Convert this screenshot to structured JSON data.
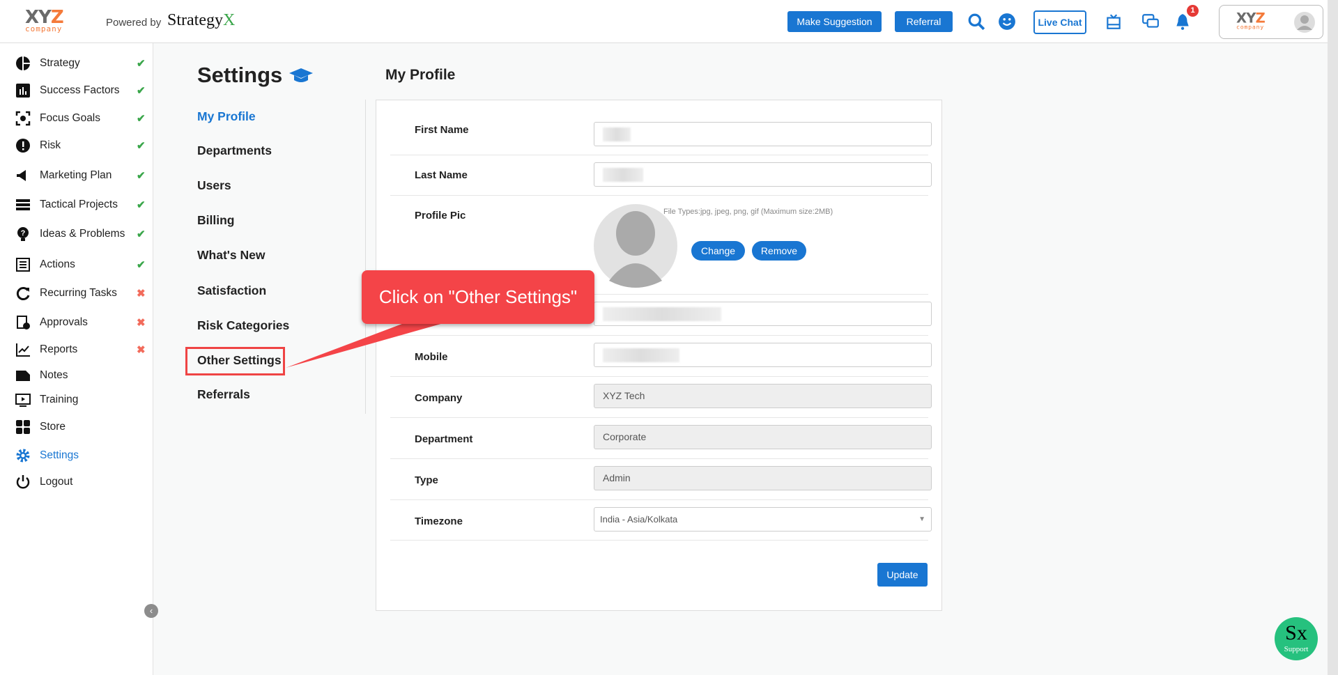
{
  "header": {
    "logo_text": "XYZ",
    "logo_sub": "company",
    "powered_by": "Powered by",
    "brand": "Strategy",
    "brand_x": "X",
    "make_suggestion": "Make Suggestion",
    "referral": "Referral",
    "live_chat": "Live Chat",
    "notification_count": "1"
  },
  "sidebar": {
    "items": [
      {
        "label": "Strategy",
        "icon": "pie-chart-icon",
        "status": "✔",
        "state": "ok"
      },
      {
        "label": "Success Factors",
        "icon": "bar-chart-icon",
        "status": "✔",
        "state": "ok"
      },
      {
        "label": "Focus Goals",
        "icon": "target-icon",
        "status": "✔",
        "state": "ok"
      },
      {
        "label": "Risk",
        "icon": "exclamation-icon",
        "status": "✔",
        "state": "ok"
      },
      {
        "label": "Marketing Plan",
        "icon": "megaphone-icon",
        "status": "✔",
        "state": "ok"
      },
      {
        "label": "Tactical Projects",
        "icon": "bars-icon",
        "status": "✔",
        "state": "ok"
      },
      {
        "label": "Ideas & Problems",
        "icon": "lightbulb-question-icon",
        "status": "✔",
        "state": "ok"
      },
      {
        "label": "Actions",
        "icon": "list-icon",
        "status": "✔",
        "state": "ok"
      },
      {
        "label": "Recurring Tasks",
        "icon": "refresh-icon",
        "status": "✖",
        "state": "no"
      },
      {
        "label": "Approvals",
        "icon": "approval-icon",
        "status": "✖",
        "state": "no"
      },
      {
        "label": "Reports",
        "icon": "line-chart-icon",
        "status": "✖",
        "state": "no"
      },
      {
        "label": "Notes",
        "icon": "note-icon",
        "status": "",
        "state": ""
      },
      {
        "label": "Training",
        "icon": "video-icon",
        "status": "",
        "state": ""
      },
      {
        "label": "Store",
        "icon": "grid-icon",
        "status": "",
        "state": ""
      },
      {
        "label": "Settings",
        "icon": "gear-icon",
        "status": "",
        "state": "active"
      },
      {
        "label": "Logout",
        "icon": "power-icon",
        "status": "",
        "state": ""
      }
    ]
  },
  "settings": {
    "title": "Settings",
    "nav": [
      "My Profile",
      "Departments",
      "Users",
      "Billing",
      "What's New",
      "Satisfaction",
      "Risk Categories",
      "Other Settings",
      "Referrals"
    ]
  },
  "profile": {
    "title": "My Profile",
    "first_name_label": "First Name",
    "last_name_label": "Last Name",
    "pic_label": "Profile Pic",
    "file_types": "File Types:jpg, jpeg, png, gif (Maximum size:2MB)",
    "change": "Change",
    "remove": "Remove",
    "mobile_label": "Mobile",
    "company_label": "Company",
    "company": "XYZ Tech",
    "department_label": "Department",
    "department": "Corporate",
    "type_label": "Type",
    "type": "Admin",
    "timezone_label": "Timezone",
    "timezone": "India - Asia/Kolkata",
    "update": "Update"
  },
  "callout": {
    "text": "Click on \"Other Settings\""
  },
  "support": {
    "mark": "Sx",
    "label": "Support"
  },
  "colors": {
    "primary": "#1976d2",
    "callout": "#f44448",
    "ok": "#3aa64a",
    "error": "#f26b5b",
    "support": "#26c17e"
  }
}
